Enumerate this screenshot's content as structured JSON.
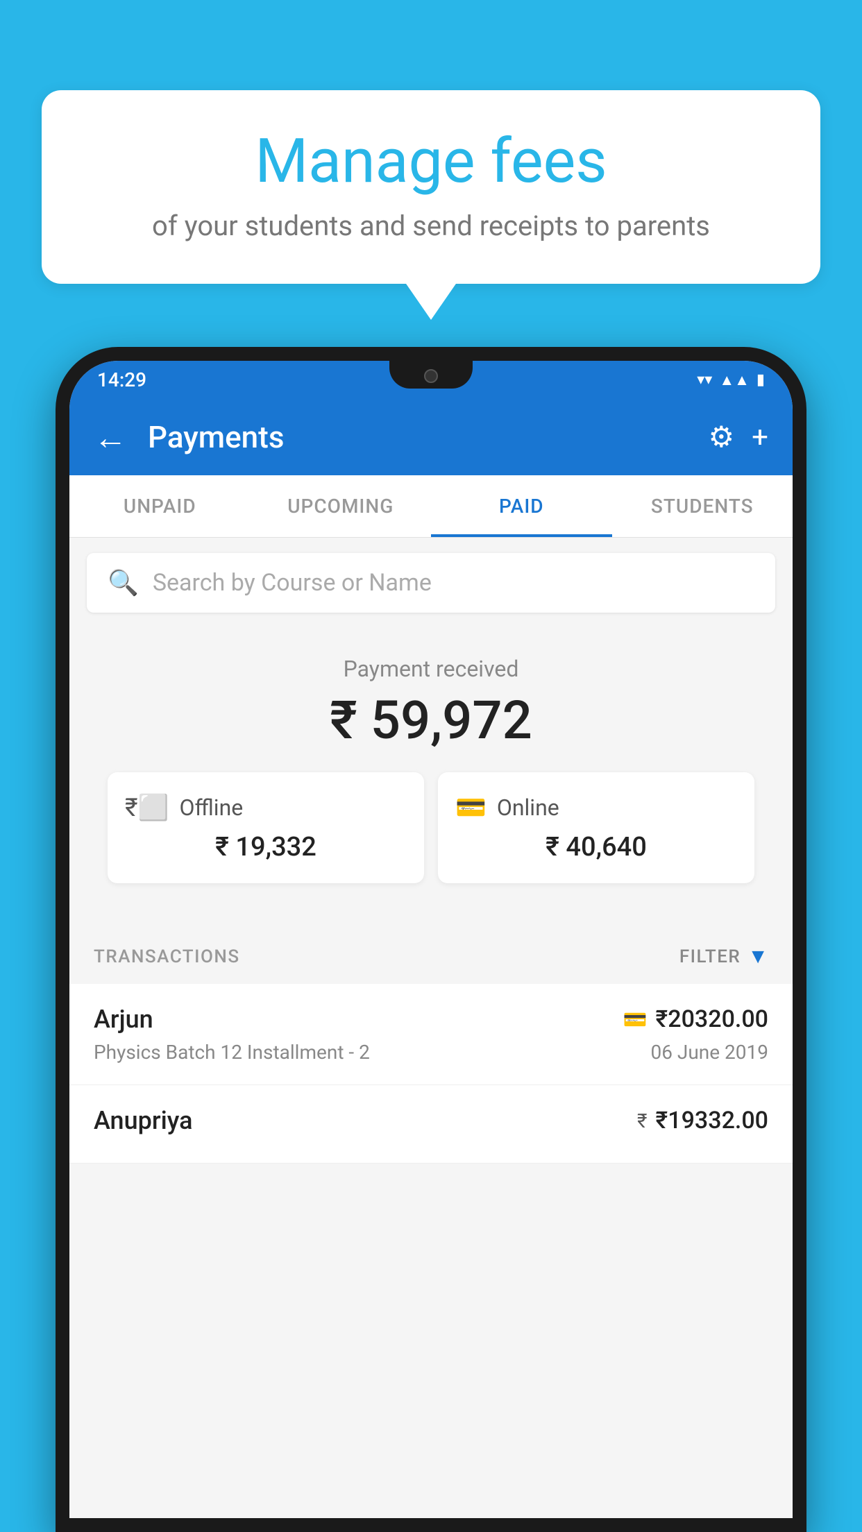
{
  "background_color": "#29b6e8",
  "speech_bubble": {
    "heading": "Manage fees",
    "subtext": "of your students and send receipts to parents"
  },
  "status_bar": {
    "time": "14:29"
  },
  "app_bar": {
    "title": "Payments",
    "back_icon": "←",
    "settings_icon": "⚙",
    "add_icon": "+"
  },
  "tabs": [
    {
      "label": "UNPAID",
      "active": false
    },
    {
      "label": "UPCOMING",
      "active": false
    },
    {
      "label": "PAID",
      "active": true
    },
    {
      "label": "STUDENTS",
      "active": false
    }
  ],
  "search": {
    "placeholder": "Search by Course or Name"
  },
  "payment_received": {
    "label": "Payment received",
    "total": "₹ 59,972",
    "offline": {
      "icon": "₹",
      "label": "Offline",
      "amount": "₹ 19,332"
    },
    "online": {
      "icon": "💳",
      "label": "Online",
      "amount": "₹ 40,640"
    }
  },
  "transactions": {
    "section_label": "TRANSACTIONS",
    "filter_label": "FILTER",
    "items": [
      {
        "name": "Arjun",
        "amount": "₹20320.00",
        "course": "Physics Batch 12 Installment - 2",
        "date": "06 June 2019",
        "payment_icon": "💳"
      },
      {
        "name": "Anupriya",
        "amount": "₹19332.00",
        "course": "",
        "date": "",
        "payment_icon": "₹"
      }
    ]
  }
}
